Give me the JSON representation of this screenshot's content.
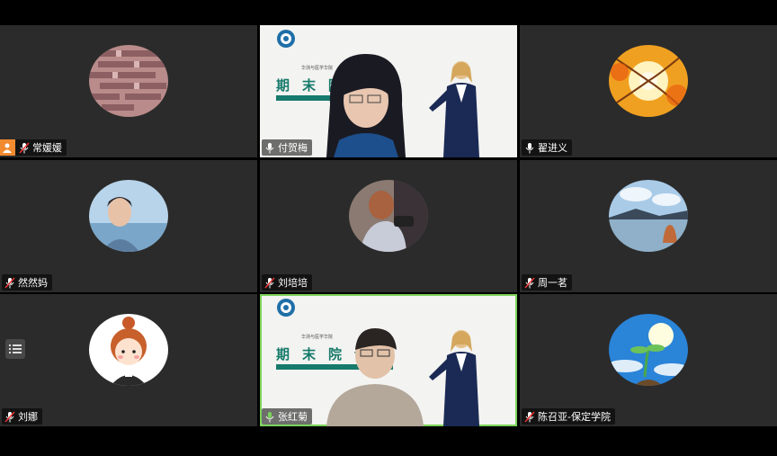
{
  "participants": [
    {
      "name": "常媛媛",
      "mic": "muted",
      "badge": "user-icon"
    },
    {
      "name": "付贺梅",
      "mic": "on",
      "video": true,
      "banner": "期末院训",
      "banner_sub": "华测与医学华院"
    },
    {
      "name": "翟进义",
      "mic": "on"
    },
    {
      "name": "然然妈",
      "mic": "muted"
    },
    {
      "name": "刘培培",
      "mic": "muted"
    },
    {
      "name": "周一茗",
      "mic": "muted"
    },
    {
      "name": "刘娜",
      "mic": "muted"
    },
    {
      "name": "张红菊",
      "mic": "on",
      "video": true,
      "active": true,
      "banner": "期末院训",
      "banner_sub": "华测与医学华院"
    },
    {
      "name": "陈召亚-保定学院",
      "mic": "muted"
    }
  ],
  "colors": {
    "active_border": "#7bd35a",
    "tile_bg": "#2b2b2b",
    "badge": "#f28a30"
  }
}
